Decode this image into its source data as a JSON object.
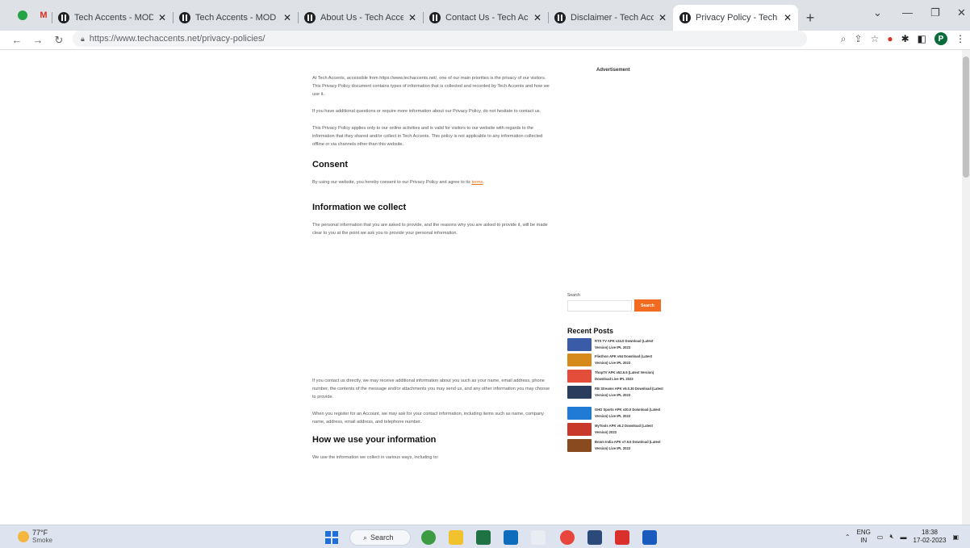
{
  "browser": {
    "tabs": [
      {
        "label": "Tech Accents - MOD APK",
        "active": false
      },
      {
        "label": "Tech Accents - MOD APK",
        "active": false
      },
      {
        "label": "About Us - Tech Accents",
        "active": false
      },
      {
        "label": "Contact Us - Tech Accents",
        "active": false
      },
      {
        "label": "Disclaimer - Tech Accents",
        "active": false
      },
      {
        "label": "Privacy Policy - Tech Accents",
        "active": true
      }
    ],
    "url": "https://www.techaccents.net/privacy-policies/",
    "profile_initial": "P",
    "new_tab_symbol": "+",
    "close_symbol": "✕"
  },
  "page": {
    "intro": [
      "At Tech Accents, accessible from https://www.techaccents.net/, one of our main priorities is the privacy of our visitors. This Privacy Policy document contains types of information that is collected and recorded by Tech Accents and how we use it.",
      "If you have additional questions or require more information about our Privacy Policy, do not hesitate to contact us.",
      "This Privacy Policy applies only to our online activities and is valid for visitors to our website with regards to the information that they shared and/or collect in Tech Accents. This policy is not applicable to any information collected offline or via channels other than this website."
    ],
    "consent_heading": "Consent",
    "consent_text": "By using our website, you hereby consent to our Privacy Policy and agree to its",
    "consent_link": "terms",
    "consent_end": ".",
    "collect_heading": "Information we collect",
    "collect_text": "The personal information that you are asked to provide, and the reasons why you are asked to provide it, will be made clear to you at the point we ask you to provide your personal information.",
    "contact_text": "If you contact us directly, we may receive additional information about you such as your name, email address, phone number, the contents of the message and/or attachments you may send us, and any other information you may choose to provide.",
    "register_text": "When you register for an Account, we may ask for your contact information, including items such as name, company name, address, email address, and telephone number.",
    "use_heading": "How we use your information",
    "use_text": "We use the information we collect in various ways, including to:"
  },
  "sidebar": {
    "ad_label": "Advertisement",
    "search_label": "Search",
    "search_button": "Search",
    "recent_title": "Recent Posts",
    "posts": [
      {
        "title": "RTS TV APK v24.0 Download (Latest Version) Live IPL 2023",
        "color": "#3a5ba8"
      },
      {
        "title": "Fliezhon APK v64 Download (Latest Version) Live IPL 2023",
        "color": "#d68a1c"
      },
      {
        "title": "ThopTV APK v52.6.9 (Latest Version) Download Live IPL 2023",
        "color": "#e44d3a"
      },
      {
        "title": "RB Streams APK v9.0.30 Download (Latest Version) Live IPL 2023",
        "color": "#2b3d5c"
      },
      {
        "title": "GHD Sports APK v20.0 Download (Latest Version) Live IPL 2023",
        "color": "#1f7bd6"
      },
      {
        "title": "MyTools APK v6.2 Download (Latest Version) 2023",
        "color": "#c9392b"
      },
      {
        "title": "Boom India APK v7.9.5 Download (Latest Version) Live IPL 2023",
        "color": "#8a4a20"
      }
    ]
  },
  "taskbar": {
    "temp": "77°F",
    "condition": "Smoke",
    "search": "Search",
    "lang_top": "ENG",
    "lang_bottom": "IN",
    "time": "18:38",
    "date": "17-02-2023"
  }
}
